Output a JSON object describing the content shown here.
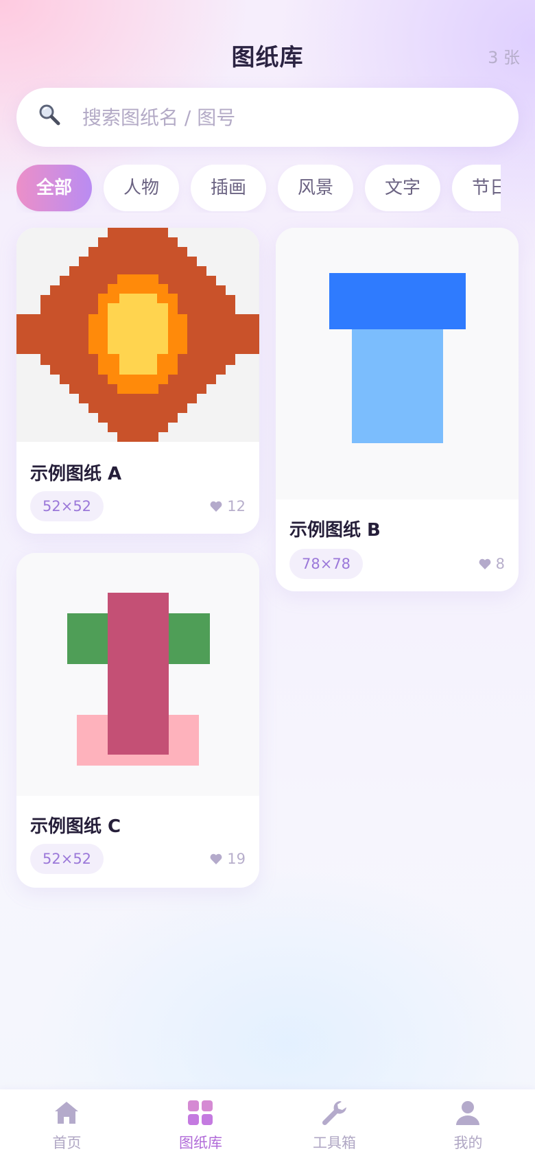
{
  "header": {
    "title": "图纸库",
    "count": "3 张"
  },
  "search": {
    "placeholder": "搜索图纸名 / 图号",
    "value": ""
  },
  "categories": [
    {
      "label": "全部",
      "active": true
    },
    {
      "label": "人物",
      "active": false
    },
    {
      "label": "插画",
      "active": false
    },
    {
      "label": "风景",
      "active": false
    },
    {
      "label": "文字",
      "active": false
    },
    {
      "label": "节日",
      "active": false
    }
  ],
  "cards": [
    {
      "title": "示例图纸 A",
      "size": "52×52",
      "likes": "12",
      "icon": "heart-icon"
    },
    {
      "title": "示例图纸 B",
      "size": "78×78",
      "likes": "8",
      "icon": "heart-icon"
    },
    {
      "title": "示例图纸 C",
      "size": "52×52",
      "likes": "19",
      "icon": "heart-icon"
    }
  ],
  "nav": [
    {
      "label": "首页",
      "icon": "home-icon",
      "active": false
    },
    {
      "label": "图纸库",
      "icon": "grid-icon",
      "active": true
    },
    {
      "label": "工具箱",
      "icon": "wrench-icon",
      "active": false
    },
    {
      "label": "我的",
      "icon": "user-icon",
      "active": false
    }
  ],
  "colors": {
    "accent_start": "#ec8fc8",
    "accent_end": "#b98cf2",
    "badge_text": "#9b78d9",
    "nav_active": "#b06ad8"
  }
}
